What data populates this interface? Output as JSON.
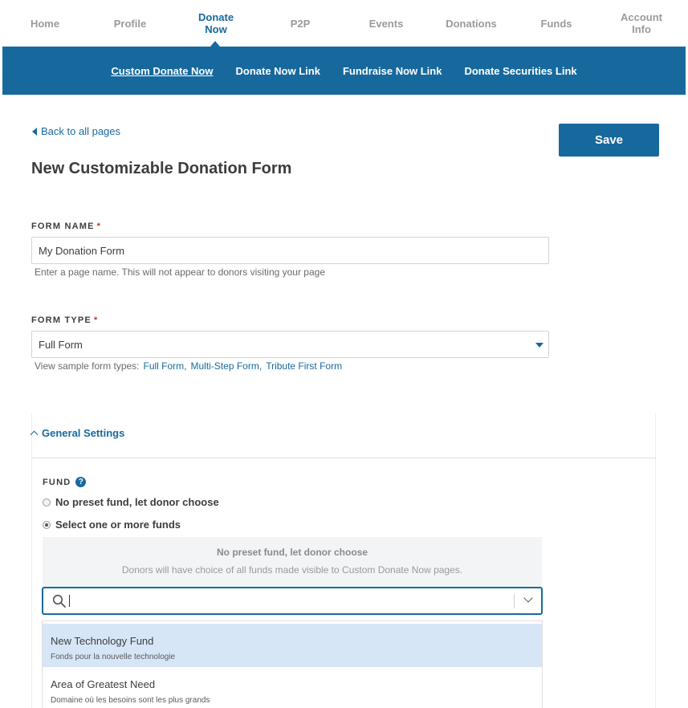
{
  "topnav": {
    "items": [
      {
        "label": "Home"
      },
      {
        "label": "Profile"
      },
      {
        "label": "Donate Now"
      },
      {
        "label": "P2P"
      },
      {
        "label": "Events"
      },
      {
        "label": "Donations"
      },
      {
        "label": "Funds"
      },
      {
        "label": "Account Info"
      }
    ],
    "active": "Donate Now",
    "active_color": "#17699d"
  },
  "subnav": {
    "items": [
      {
        "label": "Custom Donate Now"
      },
      {
        "label": "Donate Now Link"
      },
      {
        "label": "Fundraise Now Link"
      },
      {
        "label": "Donate Securities Link"
      }
    ],
    "active": "Custom Donate Now",
    "background": "#17699d"
  },
  "back_link": "Back to all pages",
  "save_label": "Save",
  "page_title": "New Customizable Donation Form",
  "form_name": {
    "label": "FORM NAME",
    "required_mark": "*",
    "value": "My Donation Form",
    "help": "Enter a page name. This will not appear to donors visiting your page"
  },
  "form_type": {
    "label": "FORM TYPE",
    "required_mark": "*",
    "value": "Full Form",
    "samples_prefix": "View sample form types:",
    "samples": [
      "Full Form,",
      "Multi-Step Form,",
      "Tribute First Form"
    ]
  },
  "general_settings": {
    "title": "General Settings",
    "fund_label": "FUND",
    "help_glyph": "?",
    "radio_options": [
      {
        "label": "No preset fund, let donor choose",
        "checked": false
      },
      {
        "label": "Select one or more funds",
        "checked": true
      }
    ],
    "info_title": "No preset fund, let donor choose",
    "info_sub": "Donors will have choice of all funds made visible to Custom Donate Now pages.",
    "search_value": "",
    "dropdown": [
      {
        "name": "New Technology Fund",
        "sub": "Fonds pour la nouvelle technologie",
        "highlighted": true
      },
      {
        "name": "Area of Greatest Need",
        "sub": "Domaine où les besoins sont les plus grands",
        "highlighted": false
      }
    ]
  }
}
